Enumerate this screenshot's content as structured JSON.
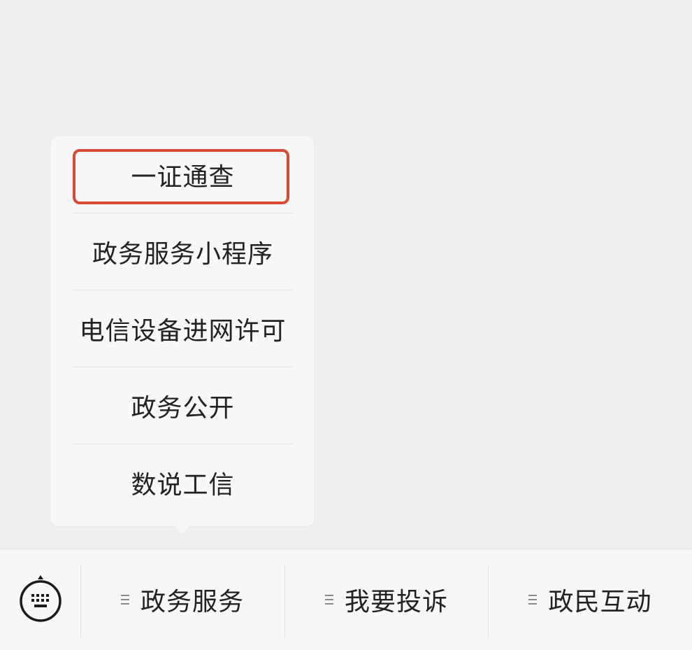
{
  "submenu": {
    "items": [
      {
        "label": "一证通查"
      },
      {
        "label": "政务服务小程序"
      },
      {
        "label": "电信设备进网许可"
      },
      {
        "label": "政务公开"
      },
      {
        "label": "数说工信"
      }
    ],
    "highlight_color": "#d84a32"
  },
  "bottom_bar": {
    "keyboard_icon": "keyboard-icon",
    "tabs": [
      {
        "label": "政务服务",
        "icon": "menu-lines-icon"
      },
      {
        "label": "我要投诉",
        "icon": "menu-lines-icon"
      },
      {
        "label": "政民互动",
        "icon": "menu-lines-icon"
      }
    ]
  }
}
